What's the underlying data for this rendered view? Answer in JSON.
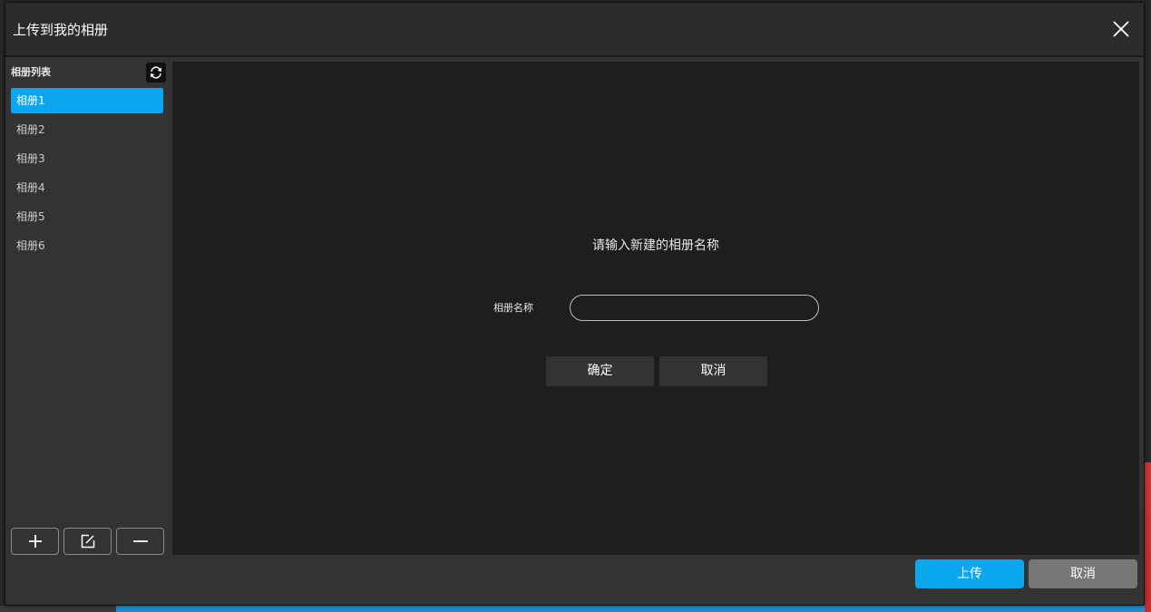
{
  "dialog": {
    "title": "上传到我的相册"
  },
  "sidebar": {
    "header": "相册列表",
    "albums": [
      {
        "label": "相册1"
      },
      {
        "label": "相册2"
      },
      {
        "label": "相册3"
      },
      {
        "label": "相册4"
      },
      {
        "label": "相册5"
      },
      {
        "label": "相册6"
      }
    ],
    "selected_index": 0,
    "tools": {
      "add_icon": "plus-icon",
      "rename_icon": "edit-icon",
      "remove_icon": "minus-icon"
    }
  },
  "form": {
    "prompt": "请输入新建的相册名称",
    "name_label": "相册名称",
    "name_value": "",
    "confirm_label": "确定",
    "cancel_label": "取消"
  },
  "footer": {
    "upload_label": "上传",
    "cancel_label": "取消"
  },
  "colors": {
    "accent": "#0aa6ee",
    "secondary_button": "#777777"
  }
}
